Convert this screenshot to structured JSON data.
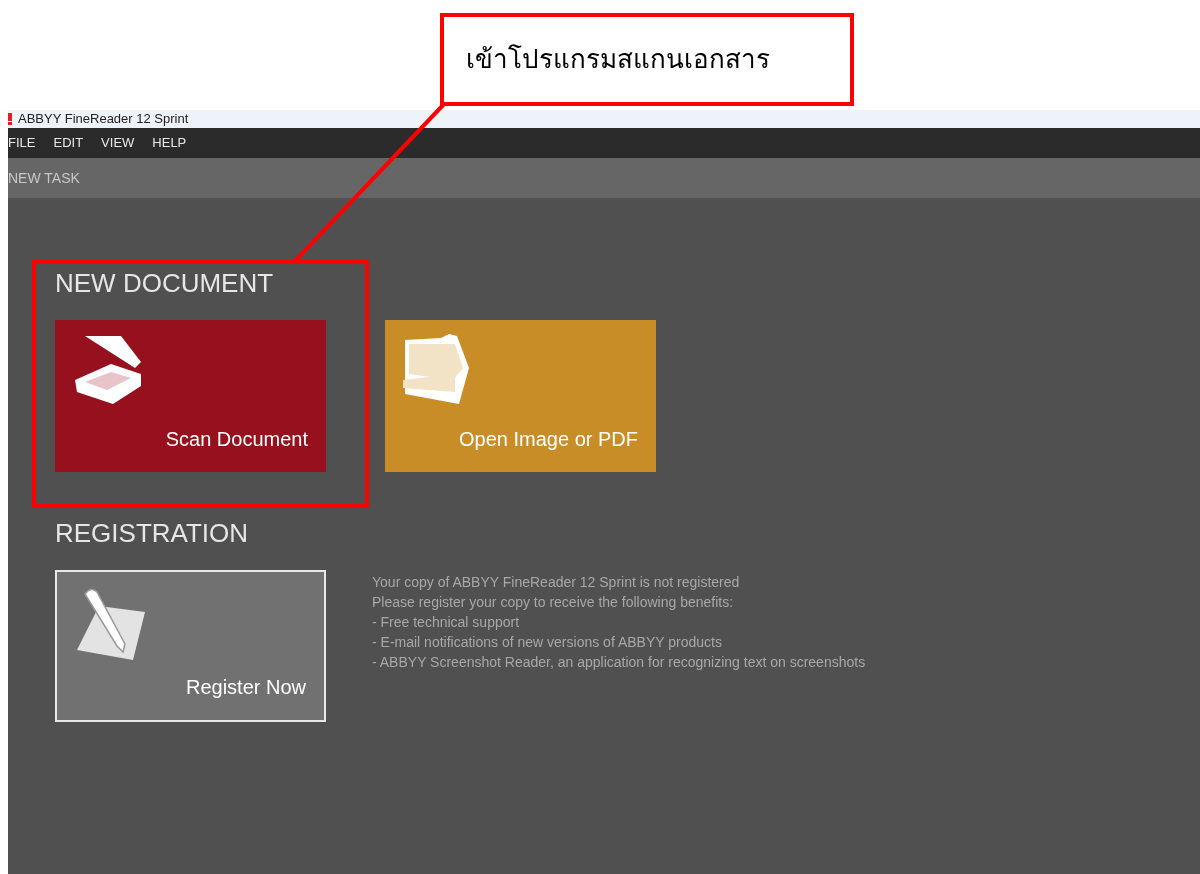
{
  "annotation": {
    "label": "เข้าโปรแกรมสแกนเอกสาร"
  },
  "window": {
    "title": "ABBYY FineReader 12 Sprint"
  },
  "menu": [
    "FILE",
    "EDIT",
    "VIEW",
    "HELP"
  ],
  "toolbar": {
    "title": "NEW TASK"
  },
  "sections": [
    {
      "heading": "NEW DOCUMENT",
      "tiles": [
        {
          "kind": "scan",
          "label": "Scan Document",
          "color": "#96101e"
        },
        {
          "kind": "open",
          "label": "Open Image or PDF",
          "color": "#c98d28"
        }
      ]
    },
    {
      "heading": "REGISTRATION",
      "tiles": [
        {
          "kind": "register",
          "label": "Register Now",
          "color": "#717171"
        }
      ],
      "notice": [
        "Your copy of ABBYY FineReader 12 Sprint is not registered",
        "Please register your copy to receive the following benefits:",
        "- Free technical support",
        "- E-mail notifications of new versions of ABBYY products",
        "- ABBYY Screenshot Reader, an application for recognizing text on screenshots"
      ]
    }
  ]
}
